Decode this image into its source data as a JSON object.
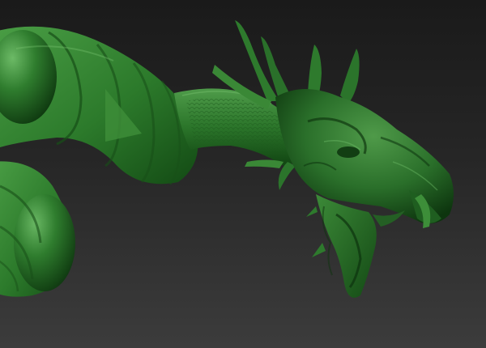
{
  "scene": {
    "subject": "dragon-sculpt",
    "material_color": "#2f7a2f",
    "material_highlight": "#5fae5a",
    "material_shadow": "#0f330f",
    "background_top": "#1a1a1a",
    "background_bottom": "#3c3c3c"
  }
}
